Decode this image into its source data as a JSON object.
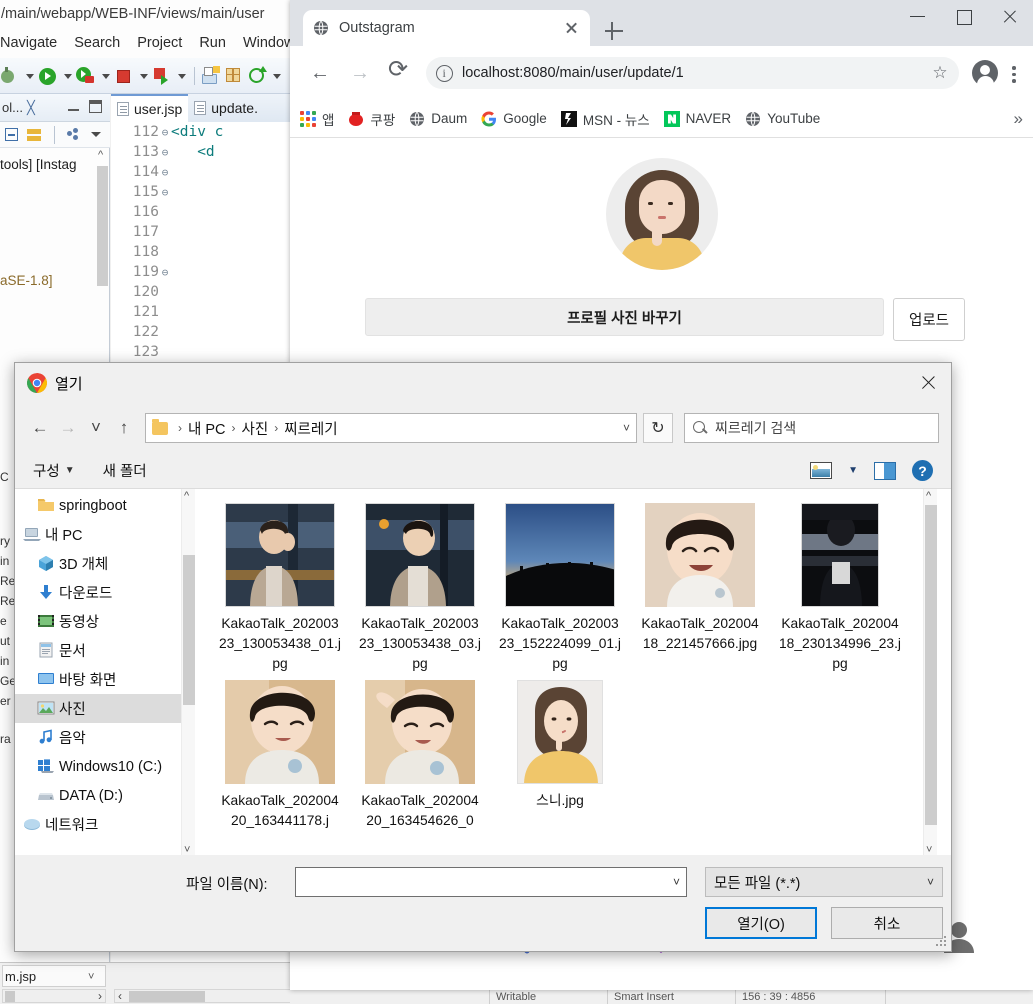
{
  "eclipse": {
    "path": "/main/webapp/WEB-INF/views/main/user",
    "menu": [
      "Navigate",
      "Search",
      "Project",
      "Run",
      "Window"
    ],
    "left_panel": {
      "tab_label": "ol...",
      "rows": [
        "tools] [Instag",
        "aSE-1.8]"
      ]
    },
    "editor_tabs": [
      {
        "label": "user.jsp"
      },
      {
        "label": "update."
      }
    ],
    "code_lines": [
      {
        "num": "112",
        "fold": "⊖",
        "text": "<div c"
      },
      {
        "num": "113",
        "fold": "⊖",
        "text": "   <d"
      },
      {
        "num": "114",
        "fold": "⊖",
        "text": ""
      },
      {
        "num": "115",
        "fold": "⊖",
        "text": ""
      },
      {
        "num": "116",
        "fold": "",
        "text": ""
      },
      {
        "num": "117",
        "fold": "",
        "text": ""
      },
      {
        "num": "118",
        "fold": "",
        "text": ""
      },
      {
        "num": "119",
        "fold": "⊖",
        "text": ""
      },
      {
        "num": "120",
        "fold": "",
        "text": ""
      },
      {
        "num": "121",
        "fold": "",
        "text": ""
      },
      {
        "num": "122",
        "fold": "",
        "text": ""
      },
      {
        "num": "123",
        "fold": "",
        "text": ""
      }
    ],
    "left_edge_fragments": [
      "C",
      "ry",
      "in",
      "Re",
      "Re",
      "e",
      "ut",
      "in",
      "Ge",
      "er",
      "ra"
    ],
    "bottom_tab": "m.jsp",
    "status": [
      "Writable",
      "Smart Insert",
      "156 : 39 : 4856"
    ]
  },
  "chrome": {
    "tab": {
      "title": "Outstagram",
      "favicon": "globe-icon"
    },
    "new_tab_label": "+",
    "window_controls": [
      "minimize",
      "maximize",
      "close"
    ],
    "omnibox": {
      "url": "localhost:8080/main/user/update/1",
      "security_icon": "info-circle-icon",
      "star_icon": "☆"
    },
    "bookmarks": [
      {
        "label": "앱",
        "icon": "apps-grid-icon"
      },
      {
        "label": "쿠팡",
        "icon": "coupang-icon"
      },
      {
        "label": "Daum",
        "icon": "globe-icon"
      },
      {
        "label": "Google",
        "icon": "google-g-icon"
      },
      {
        "label": "MSN - 뉴스",
        "icon": "msn-icon"
      },
      {
        "label": "NAVER",
        "icon": "naver-n-icon"
      },
      {
        "label": "YouTube",
        "icon": "globe-icon"
      }
    ],
    "bookmarks_overflow": "»"
  },
  "page": {
    "profile_avatar_alt": "user-profile-photo",
    "change_photo_label": "프로필 사진 바꾸기",
    "upload_label": "업로드",
    "bottom_nav": [
      {
        "name": "home-icon",
        "color": "#3ddc49"
      },
      {
        "name": "search-icon",
        "color": "#4a72d6"
      },
      {
        "name": "add-post-icon",
        "color": "#a23bd6"
      },
      {
        "name": "heart-icon",
        "color": "#f0424a"
      },
      {
        "name": "profile-icon",
        "color": "#6e6e6e"
      }
    ]
  },
  "dialog": {
    "title": "열기",
    "breadcrumb": [
      "내 PC",
      "사진",
      "찌르레기"
    ],
    "search_placeholder": "찌르레기 검색",
    "commands": {
      "organize": "구성",
      "new_folder": "새 폴더"
    },
    "sidebar": [
      {
        "label": "springboot",
        "icon": "folder-icon",
        "selected": false,
        "sub": true
      },
      {
        "label": "내 PC",
        "icon": "this-pc-icon",
        "selected": false,
        "sub": false
      },
      {
        "label": "3D 개체",
        "icon": "3d-objects-icon",
        "selected": false,
        "sub": true
      },
      {
        "label": "다운로드",
        "icon": "downloads-icon",
        "selected": false,
        "sub": true
      },
      {
        "label": "동영상",
        "icon": "videos-icon",
        "selected": false,
        "sub": true
      },
      {
        "label": "문서",
        "icon": "documents-icon",
        "selected": false,
        "sub": true
      },
      {
        "label": "바탕 화면",
        "icon": "desktop-icon",
        "selected": false,
        "sub": true
      },
      {
        "label": "사진",
        "icon": "pictures-icon",
        "selected": true,
        "sub": true
      },
      {
        "label": "음악",
        "icon": "music-icon",
        "selected": false,
        "sub": true
      },
      {
        "label": "Windows10 (C:)",
        "icon": "drive-windows-icon",
        "selected": false,
        "sub": true
      },
      {
        "label": "DATA (D:)",
        "icon": "drive-icon",
        "selected": false,
        "sub": true
      },
      {
        "label": "네트워크",
        "icon": "network-icon",
        "selected": false,
        "sub": false
      }
    ],
    "files": [
      {
        "name": "KakaoTalk_20200323_130053438_01.jpg",
        "kind": "man-drinking"
      },
      {
        "name": "KakaoTalk_20200323_130053438_03.jpg",
        "kind": "man-portrait"
      },
      {
        "name": "KakaoTalk_20200323_152224099_01.jpg",
        "kind": "sunset-hill"
      },
      {
        "name": "KakaoTalk_20200418_221457666.jpg",
        "kind": "child-smiling"
      },
      {
        "name": "KakaoTalk_20200418_230134996_23.jpg",
        "kind": "dark-indoor"
      },
      {
        "name": "KakaoTalk_20200420_163441178.j",
        "kind": "child-looking-down"
      },
      {
        "name": "KakaoTalk_20200420_163454626_0",
        "kind": "child-hand-up"
      },
      {
        "name": "스니.jpg",
        "kind": "woman-yellow"
      }
    ],
    "footer": {
      "filename_label": "파일 이름(N):",
      "filename_value": "",
      "filetype_value": "모든 파일 (*.*)",
      "open_button": "열기(O)",
      "cancel_button": "취소"
    }
  }
}
